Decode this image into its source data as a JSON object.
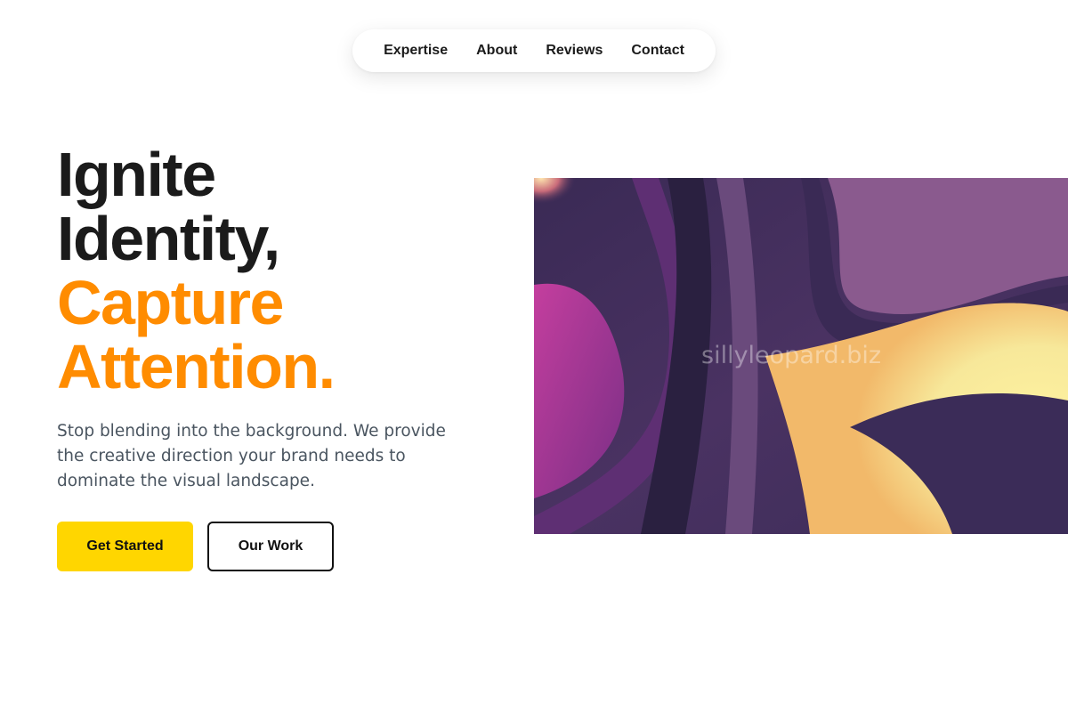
{
  "nav": {
    "items": [
      {
        "label": "Expertise"
      },
      {
        "label": "About"
      },
      {
        "label": "Reviews"
      },
      {
        "label": "Contact"
      }
    ]
  },
  "hero": {
    "headline_line1": "Ignite",
    "headline_line2": "Identity,",
    "headline_line3": "Capture",
    "headline_line4": "Attention.",
    "lead": "Stop blending into the background. We provide the creative direction your brand needs to dominate the visual landscape.",
    "primary_button": "Get Started",
    "secondary_button": "Our Work",
    "image_watermark": "sillyleopard.biz"
  },
  "colors": {
    "accent": "#ff8c00",
    "primary_button": "#ffd600",
    "text_dark": "#1b1b1b",
    "text_muted": "#4a5560"
  }
}
